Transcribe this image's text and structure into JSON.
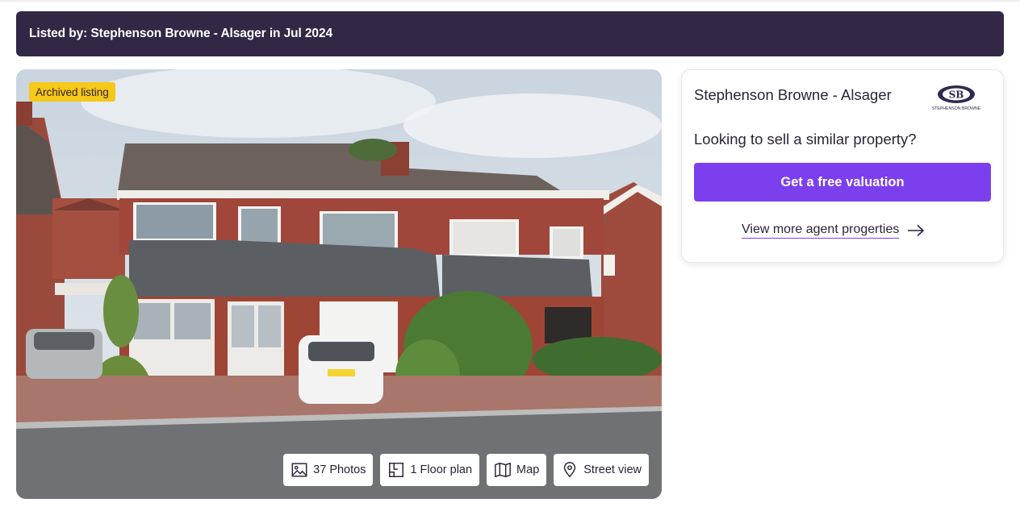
{
  "banner": {
    "text": "Listed by: Stephenson Browne - Alsager in Jul 2024"
  },
  "listing": {
    "status_badge": "Archived listing",
    "media_buttons": [
      {
        "label": "37 Photos",
        "icon": "photos-icon"
      },
      {
        "label": "1 Floor plan",
        "icon": "floor-plan-icon"
      },
      {
        "label": "Map",
        "icon": "map-icon"
      },
      {
        "label": "Street view",
        "icon": "location-pin-icon"
      }
    ]
  },
  "agent": {
    "name": "Stephenson Browne - Alsager",
    "logo_text": "STEPHENSON BROWNE",
    "prompt": "Looking to sell a similar property?",
    "cta_label": "Get a free valuation",
    "more_link_label": "View more agent progerties"
  },
  "colors": {
    "banner_bg": "#322745",
    "badge_bg": "#f6c818",
    "cta_bg": "#7b3fee",
    "text": "#2b2438"
  }
}
